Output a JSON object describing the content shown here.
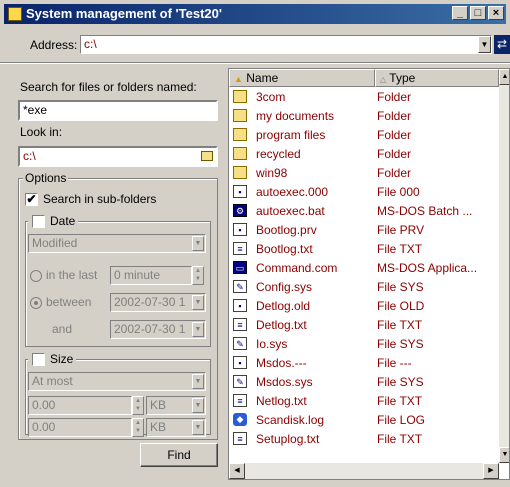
{
  "window": {
    "title": "System management of 'Test20'",
    "btn_min": "_",
    "btn_max": "□",
    "btn_close": "×"
  },
  "address": {
    "label": "Address:",
    "value": "c:\\",
    "dropdown": "▼",
    "go": "⇄"
  },
  "search": {
    "name_label": "Search for files or folders named:",
    "name_value": "*exe",
    "lookin_label": "Look in:",
    "lookin_value": "c:\\",
    "options": {
      "label": "Options",
      "subfolders_label": "Search in sub-folders",
      "subfolders_checked": true,
      "date": {
        "label": "Date",
        "checked": false,
        "mode": "Modified",
        "inlast_label": "in the last",
        "inlast_value": "0 minute",
        "between_label": "between",
        "between_value": "2002-07-30 1",
        "and_label": "and",
        "and_value": "2002-07-30 1"
      },
      "size": {
        "label": "Size",
        "checked": false,
        "mode": "At most",
        "value1": "0.00",
        "unit1": "KB",
        "value2": "0.00",
        "unit2": "KB"
      }
    },
    "find_label": "Find"
  },
  "list": {
    "columns": [
      "Name",
      "Type"
    ],
    "rows": [
      {
        "name": "3com",
        "type": "Folder",
        "icon": "folder-icon"
      },
      {
        "name": "my documents",
        "type": "Folder",
        "icon": "folder-icon"
      },
      {
        "name": "program files",
        "type": "Folder",
        "icon": "folder-icon"
      },
      {
        "name": "recycled",
        "type": "Folder",
        "icon": "folder-icon"
      },
      {
        "name": "win98",
        "type": "Folder",
        "icon": "folder-icon"
      },
      {
        "name": "autoexec.000",
        "type": "File 000",
        "icon": "file-icon"
      },
      {
        "name": "autoexec.bat",
        "type": "MS-DOS Batch ...",
        "icon": "batch-icon"
      },
      {
        "name": "Bootlog.prv",
        "type": "File PRV",
        "icon": "file-icon"
      },
      {
        "name": "Bootlog.txt",
        "type": "File TXT",
        "icon": "text-icon"
      },
      {
        "name": "Command.com",
        "type": "MS-DOS Applica...",
        "icon": "dos-app-icon"
      },
      {
        "name": "Config.sys",
        "type": "File SYS",
        "icon": "system-icon"
      },
      {
        "name": "Detlog.old",
        "type": "File OLD",
        "icon": "file-icon"
      },
      {
        "name": "Detlog.txt",
        "type": "File TXT",
        "icon": "text-icon"
      },
      {
        "name": "Io.sys",
        "type": "File SYS",
        "icon": "system-icon"
      },
      {
        "name": "Msdos.---",
        "type": "File ---",
        "icon": "file-icon"
      },
      {
        "name": "Msdos.sys",
        "type": "File SYS",
        "icon": "system-icon"
      },
      {
        "name": "Netlog.txt",
        "type": "File TXT",
        "icon": "text-icon"
      },
      {
        "name": "Scandisk.log",
        "type": "File LOG",
        "icon": "shield-icon"
      },
      {
        "name": "Setuplog.txt",
        "type": "File TXT",
        "icon": "text-icon"
      }
    ]
  }
}
